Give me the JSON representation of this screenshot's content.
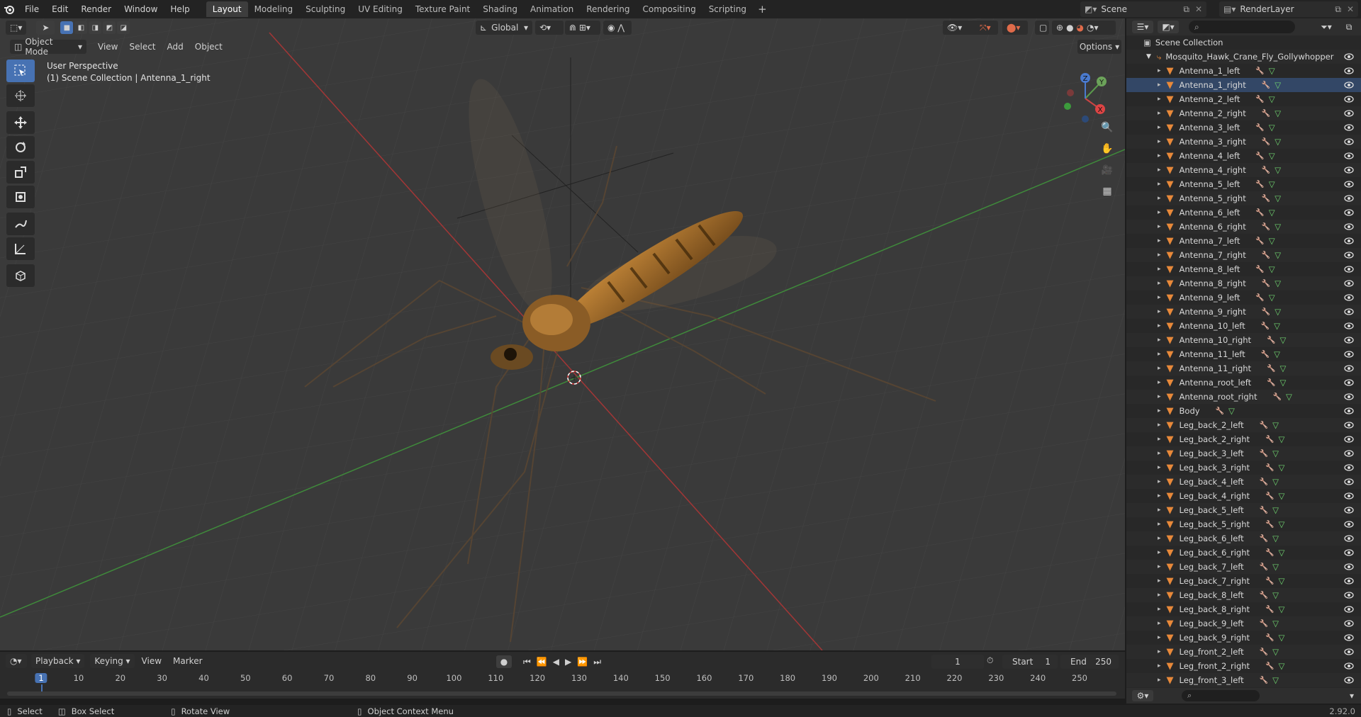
{
  "app": {
    "logo": "blender-icon",
    "version": "2.92.0"
  },
  "menu": [
    "File",
    "Edit",
    "Render",
    "Window",
    "Help"
  ],
  "workspaces": [
    "Layout",
    "Modeling",
    "Sculpting",
    "UV Editing",
    "Texture Paint",
    "Shading",
    "Animation",
    "Rendering",
    "Compositing",
    "Scripting"
  ],
  "workspace_add": "+",
  "scene": {
    "name": "Scene",
    "view_layer": "RenderLayer"
  },
  "viewport": {
    "mode": "Object Mode",
    "menus": [
      "View",
      "Select",
      "Add",
      "Object"
    ],
    "transform_orientation": "Global",
    "options_label": "Options",
    "overlay_title": "User Perspective",
    "overlay_subtitle": "(1) Scene Collection | Antenna_1_right",
    "gizmo_axes": {
      "x": "X",
      "y": "Y",
      "z": "Z"
    }
  },
  "outliner": {
    "root": "Scene Collection",
    "collection": "Mosquito_Hawk_Crane_Fly_Gollywhopper",
    "items": [
      "Antenna_1_left",
      "Antenna_1_right",
      "Antenna_2_left",
      "Antenna_2_right",
      "Antenna_3_left",
      "Antenna_3_right",
      "Antenna_4_left",
      "Antenna_4_right",
      "Antenna_5_left",
      "Antenna_5_right",
      "Antenna_6_left",
      "Antenna_6_right",
      "Antenna_7_left",
      "Antenna_7_right",
      "Antenna_8_left",
      "Antenna_8_right",
      "Antenna_9_left",
      "Antenna_9_right",
      "Antenna_10_left",
      "Antenna_10_right",
      "Antenna_11_left",
      "Antenna_11_right",
      "Antenna_root_left",
      "Antenna_root_right",
      "Body",
      "Leg_back_2_left",
      "Leg_back_2_right",
      "Leg_back_3_left",
      "Leg_back_3_right",
      "Leg_back_4_left",
      "Leg_back_4_right",
      "Leg_back_5_left",
      "Leg_back_5_right",
      "Leg_back_6_left",
      "Leg_back_6_right",
      "Leg_back_7_left",
      "Leg_back_7_right",
      "Leg_back_8_left",
      "Leg_back_8_right",
      "Leg_back_9_left",
      "Leg_back_9_right",
      "Leg_front_2_left",
      "Leg_front_2_right",
      "Leg_front_3_left"
    ],
    "selected_item": "Antenna_1_right"
  },
  "timeline": {
    "menus": [
      "Playback",
      "Keying",
      "View",
      "Marker"
    ],
    "current_frame": "1",
    "start_label": "Start",
    "start": "1",
    "end_label": "End",
    "end": "250",
    "ticks": [
      "1",
      "10",
      "20",
      "30",
      "40",
      "50",
      "60",
      "70",
      "80",
      "90",
      "100",
      "110",
      "120",
      "130",
      "140",
      "150",
      "160",
      "170",
      "180",
      "190",
      "200",
      "210",
      "220",
      "230",
      "240",
      "250"
    ]
  },
  "statusbar": {
    "items": [
      "Select",
      "Box Select",
      "Rotate View",
      "Object Context Menu"
    ]
  },
  "colors": {
    "accent": "#4772b3",
    "mesh_orange": "#e8893a",
    "x_axis": "#c33a3a",
    "y_axis": "#4d9b44"
  }
}
